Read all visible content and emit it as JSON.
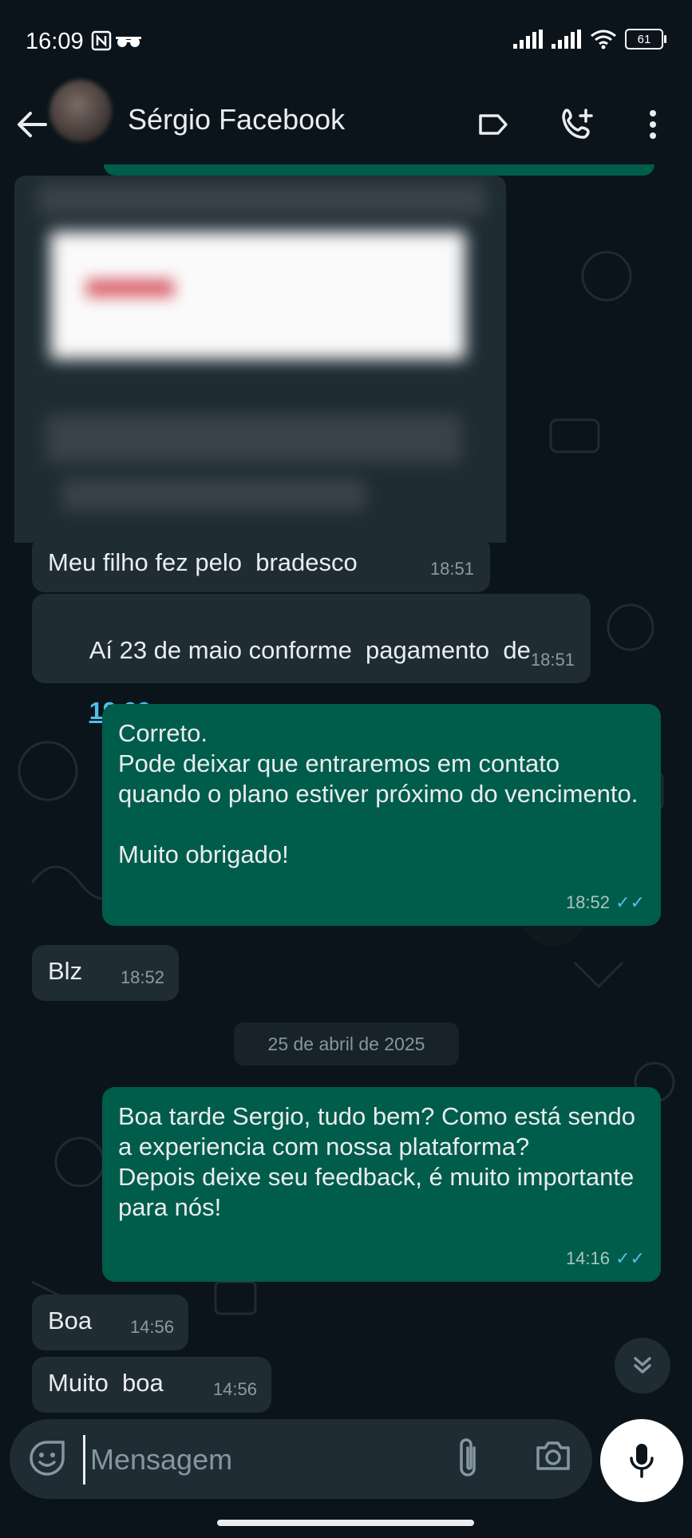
{
  "status_bar": {
    "time": "16:09",
    "battery": "61"
  },
  "header": {
    "contact_name": "Sérgio Facebook"
  },
  "messages": [
    {
      "dir": "in",
      "text": "Meu filho fez pelo  bradesco",
      "time": "18:51"
    },
    {
      "dir": "in",
      "text_prefix": "Aí 23 de maio conforme  pagamento  de",
      "link": "19.99",
      "time": "18:51"
    },
    {
      "dir": "out",
      "text": "Correto.\nPode deixar que entraremos em contato quando o plano estiver próximo do vencimento.\n\nMuito obrigado!",
      "time": "18:52",
      "status": "read"
    },
    {
      "dir": "in",
      "text": "Blz",
      "time": "18:52"
    },
    {
      "dir": "out",
      "text": "Boa tarde Sergio, tudo bem? Como está sendo a experiencia com nossa plataforma?\nDepois deixe seu feedback, é muito importante para nós!",
      "time": "14:16",
      "status": "read"
    },
    {
      "dir": "in",
      "text": "Boa",
      "time": "14:56"
    },
    {
      "dir": "in",
      "text": "Muito  boa",
      "time": "14:56"
    }
  ],
  "date_divider": "25 de abril de 2025",
  "composer": {
    "placeholder": "Mensagem"
  },
  "colors": {
    "background": "#0b141a",
    "incoming_bubble": "#202c33",
    "outgoing_bubble": "#005c4b",
    "read_ticks": "#53bdeb"
  },
  "icons": [
    "back-arrow-icon",
    "label-icon",
    "add-call-icon",
    "more-vert-icon",
    "sticker-icon",
    "paperclip-icon",
    "camera-icon",
    "mic-icon",
    "double-chevron-down-icon"
  ]
}
